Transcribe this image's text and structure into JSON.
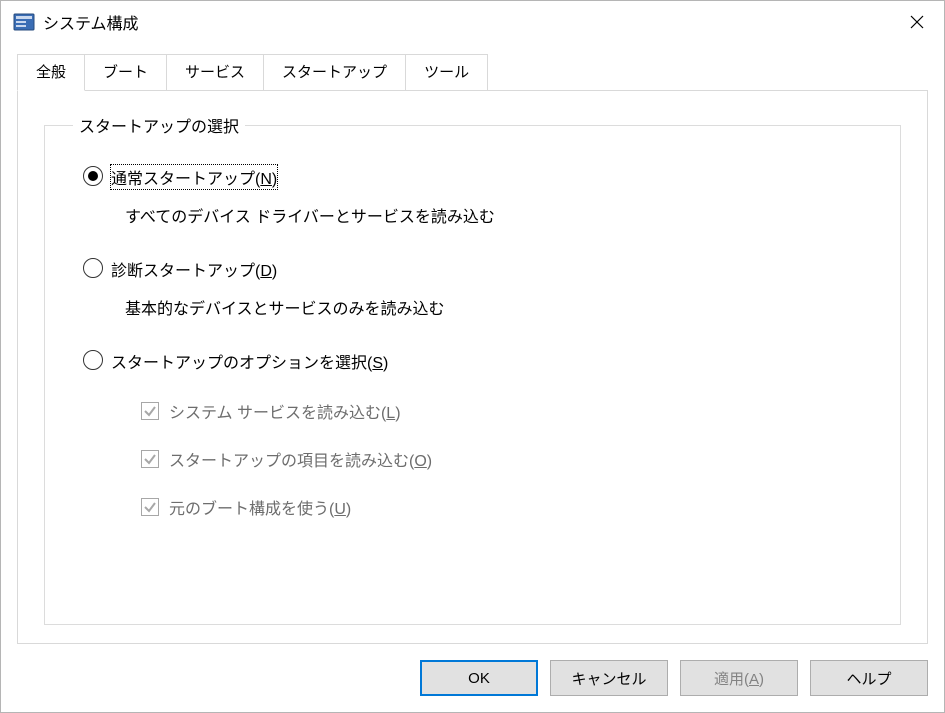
{
  "window": {
    "title": "システム構成"
  },
  "tabs": [
    {
      "label": "全般",
      "active": true
    },
    {
      "label": "ブート",
      "active": false
    },
    {
      "label": "サービス",
      "active": false
    },
    {
      "label": "スタートアップ",
      "active": false
    },
    {
      "label": "ツール",
      "active": false
    }
  ],
  "group_legend": "スタートアップの選択",
  "radios": {
    "normal": {
      "label_pre": "通常スタートアップ(",
      "accel": "N",
      "label_post": ")",
      "desc": "すべてのデバイス ドライバーとサービスを読み込む",
      "checked": true
    },
    "diagnostic": {
      "label_pre": "診断スタートアップ(",
      "accel": "D",
      "label_post": ")",
      "desc": "基本的なデバイスとサービスのみを読み込む",
      "checked": false
    },
    "selective": {
      "label_pre": "スタートアップのオプションを選択(",
      "accel": "S",
      "label_post": ")",
      "checked": false
    }
  },
  "checks": {
    "services": {
      "label_pre": "システム サービスを読み込む(",
      "accel": "L",
      "label_post": ")",
      "checked": true,
      "disabled": true
    },
    "startup": {
      "label_pre": "スタートアップの項目を読み込む(",
      "accel": "O",
      "label_post": ")",
      "checked": true,
      "disabled": true
    },
    "original_boot": {
      "label_pre": "元のブート構成を使う(",
      "accel": "U",
      "label_post": ")",
      "checked": true,
      "disabled": true
    }
  },
  "buttons": {
    "ok": "OK",
    "cancel": "キャンセル",
    "apply_pre": "適用(",
    "apply_accel": "A",
    "apply_post": ")",
    "help": "ヘルプ"
  }
}
